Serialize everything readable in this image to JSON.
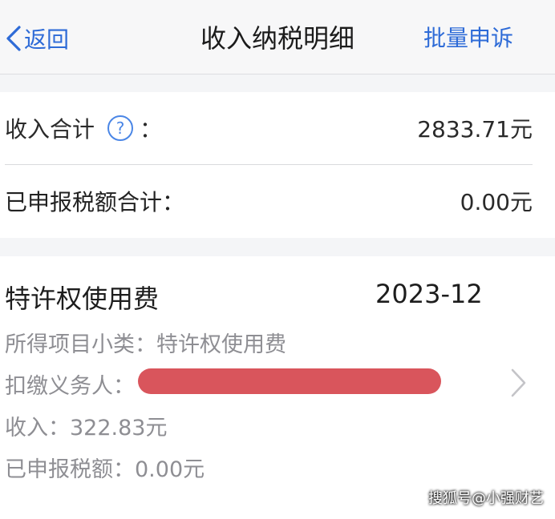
{
  "nav": {
    "back_label": "返回",
    "title": "收入纳税明细",
    "action_label": "批量申诉",
    "accent_color": "#2e6bd7"
  },
  "summary": {
    "income_total_label": "收入合计",
    "income_total_colon": "：",
    "income_total_value": "2833.71元",
    "tax_total_label": "已申报税额合计：",
    "tax_total_value": "0.00元",
    "help_icon": "question-circle-icon"
  },
  "detail": {
    "title": "特许权使用费",
    "period": "2023-12",
    "subcategory": "所得项目小类：特许权使用费",
    "withholder_label": "扣缴义务人：",
    "income": "收入：322.83元",
    "tax": "已申报税额：0.00元",
    "chevron_icon": "chevron-right-icon",
    "redaction_color": "#d9555c"
  },
  "watermark": "搜狐号@小强财艺"
}
